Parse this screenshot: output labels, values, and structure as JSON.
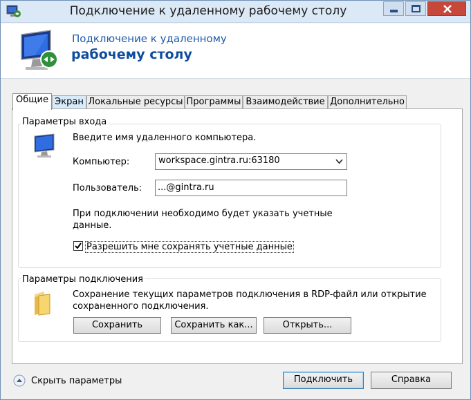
{
  "window": {
    "title": "Подключение к удаленному рабочему столу"
  },
  "banner": {
    "line1": "Подключение к удаленному",
    "line2": "рабочему столу"
  },
  "tabs": [
    {
      "label": "Общие"
    },
    {
      "label": "Экран"
    },
    {
      "label": "Локальные ресурсы"
    },
    {
      "label": "Программы"
    },
    {
      "label": "Взаимодействие"
    },
    {
      "label": "Дополнительно"
    }
  ],
  "logon": {
    "group_title": "Параметры входа",
    "prompt": "Введите имя удаленного компьютера.",
    "computer_label": "Компьютер:",
    "computer_value": "workspace.gintra.ru:63180",
    "user_label": "Пользователь:",
    "user_value": "...@gintra.ru",
    "note_line1": "При подключении необходимо будет указать учетные",
    "note_line2": "данные.",
    "save_credentials_label": "Разрешить мне сохранять учетные данные",
    "save_credentials_checked": true
  },
  "connection": {
    "group_title": "Параметры подключения",
    "desc_line1": "Сохранение текущих параметров подключения в RDP-файл или открытие",
    "desc_line2": "сохраненного подключения.",
    "save_label": "Сохранить",
    "save_as_label": "Сохранить как...",
    "open_label": "Открыть..."
  },
  "footer": {
    "hide_params_label": "Скрыть параметры",
    "connect_label": "Подключить",
    "help_label": "Справка"
  },
  "colors": {
    "accent": "#1b5aa8",
    "close_button": "#c7473a"
  }
}
